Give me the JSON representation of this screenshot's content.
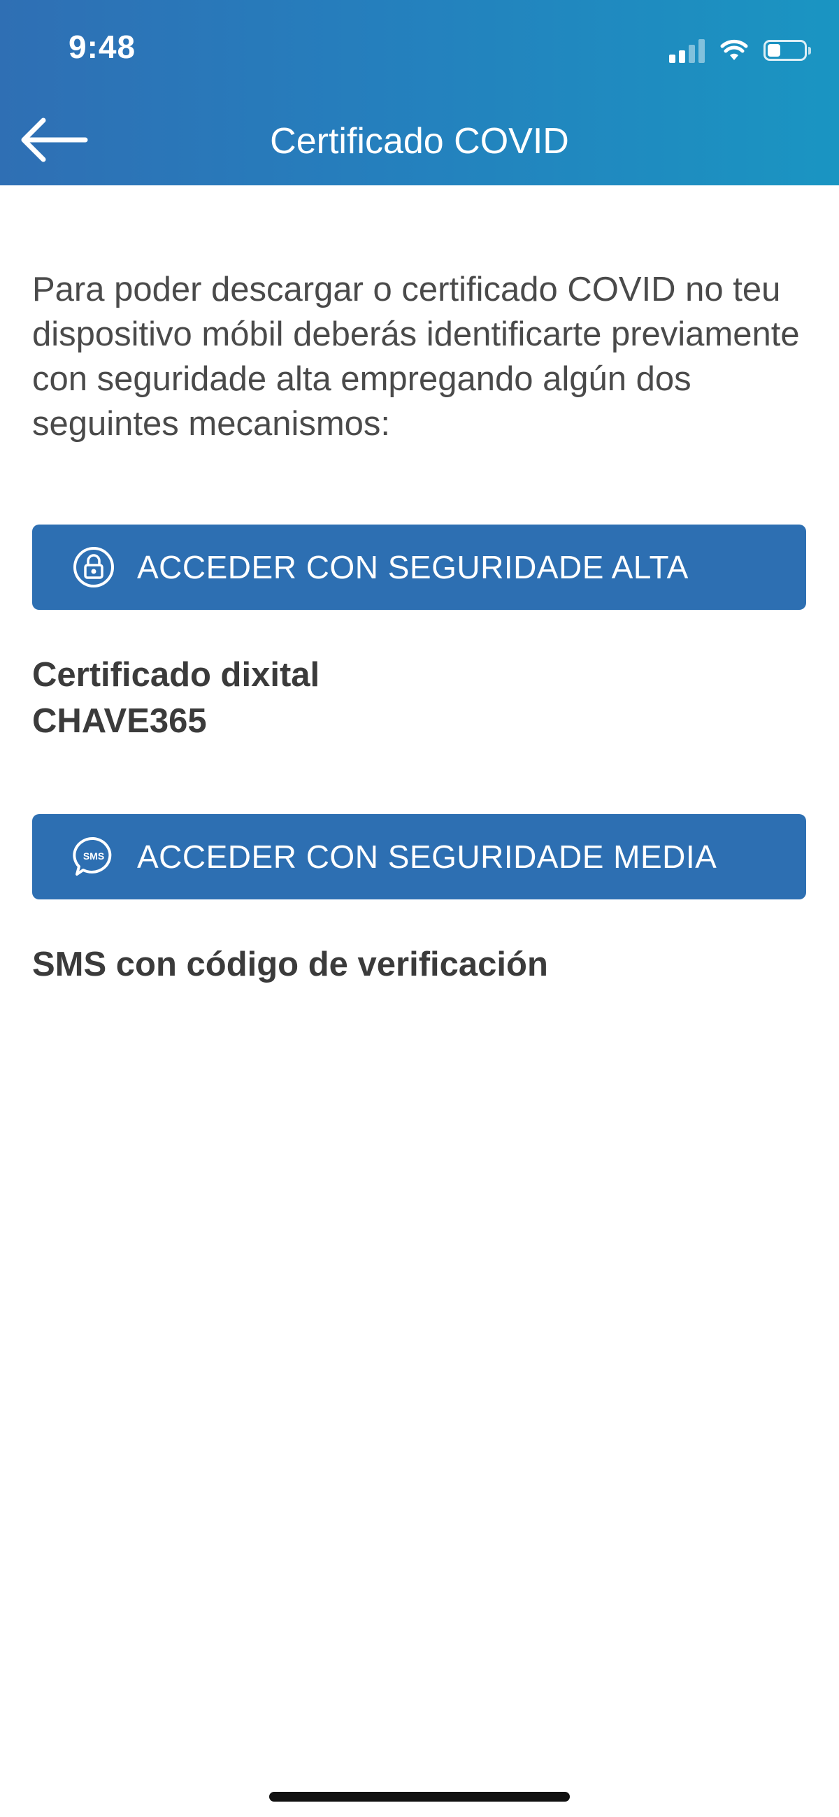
{
  "status_bar": {
    "time": "9:48",
    "icons": [
      "signal-icon",
      "wifi-icon",
      "battery-icon"
    ]
  },
  "nav": {
    "title": "Certificado COVID",
    "back_icon": "back-arrow-icon"
  },
  "intro_text": "Para poder descargar o certificado COVID no teu dispositivo móbil deberás identificarte previamente con seguridade alta empregando algún dos seguintes mecanismos:",
  "options": [
    {
      "button_label": "ACCEDER CON SEGURIDADE ALTA",
      "icon": "lock-icon",
      "method_lines": [
        "Certificado dixital",
        "CHAVE365"
      ]
    },
    {
      "button_label": "ACCEDER CON SEGURIDADE MEDIA",
      "icon": "sms-icon",
      "icon_text": "SMS",
      "method_lines": [
        "SMS con código de verificación"
      ]
    }
  ],
  "colors": {
    "header_gradient_start": "#2f6fb4",
    "header_gradient_end": "#1a95c2",
    "button_background": "#2d6fb2",
    "button_text": "#ffffff",
    "body_text": "#4a4a4a",
    "method_text": "#3b3b3b"
  }
}
